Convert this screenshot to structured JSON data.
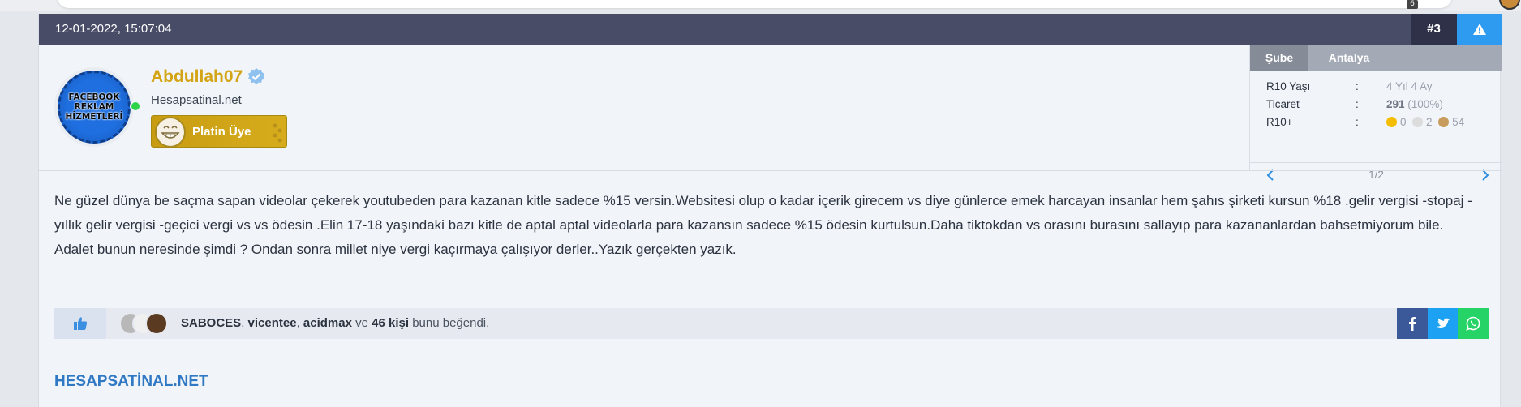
{
  "topbar": {
    "notification_count": "6"
  },
  "post": {
    "date": "12-01-2022, 15:07:04",
    "number": "#3",
    "report_icon": "warning-icon"
  },
  "user": {
    "avatar_text": [
      "FACEBOOK",
      "REKLAM",
      "HİZMETLERİ"
    ],
    "username": "Abdullah07",
    "username_color": "#d3a516",
    "verified_icon": "verified-badge-icon",
    "title": "Hesapsatinal.net",
    "rank": "Platin Üye",
    "online": true
  },
  "side": {
    "tab_label": "Şube",
    "tab_value": "Antalya",
    "rows": [
      {
        "key": "R10 Yaşı",
        "sep": ":",
        "value": "4 Yıl 4 Ay"
      },
      {
        "key": "Ticaret",
        "sep": ":",
        "bold": "291",
        "value": "(100%)"
      },
      {
        "key": "R10+",
        "sep": ":",
        "dots": [
          {
            "color": "#f5bd00",
            "count": "0"
          },
          {
            "color": "#dcdcdc",
            "count": "2"
          },
          {
            "color": "#c79c5c",
            "count": "54"
          }
        ]
      }
    ],
    "pager": "1/2"
  },
  "content": {
    "paragraph1": "Ne güzel dünya be saçma sapan videolar çekerek youtubeden para kazanan kitle sadece %15 versin.Websitesi olup o kadar içerik girecem vs diye günlerce emek harcayan insanlar hem şahıs şirketi kursun %18 .gelir vergisi -stopaj -yıllık gelir vergisi -geçici vergi vs vs ödesin .Elin 17-18 yaşındaki bazı kitle de aptal aptal videolarla para kazansın sadece %15 ödesin kurtulsun.Daha tiktokdan vs orasını burasını sallayıp para kazananlardan bahsetmiyorum bile.",
    "paragraph2": "Adalet bunun neresinde şimdi ? Ondan sonra millet niye vergi kaçırmaya çalışıyor derler..Yazık gerçekten yazık."
  },
  "likes": {
    "names": [
      "SABOCES",
      "vicentee",
      "acidmax"
    ],
    "sep1": ", ",
    "sep2": ", ",
    "and_word": " ve ",
    "others": "46 kişi",
    "suffix": " bunu beğendi."
  },
  "share": {
    "facebook_color": "#3b5998",
    "twitter_color": "#1da1f2",
    "whatsapp_color": "#25d366"
  },
  "signature": {
    "text": "HESAPSATİNAL.NET"
  }
}
